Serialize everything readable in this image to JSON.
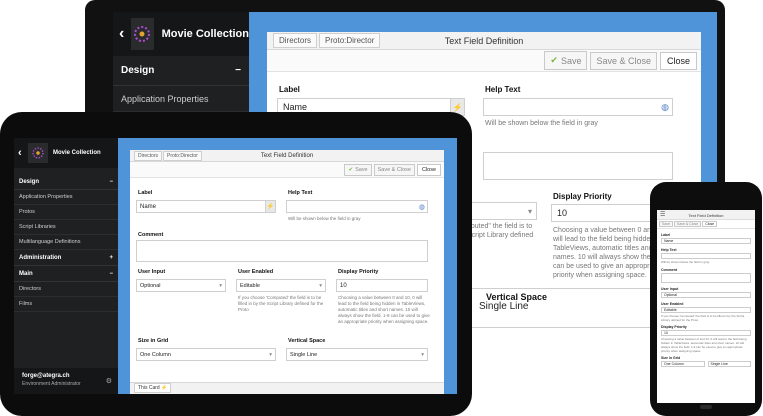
{
  "app": {
    "title": "Movie Collection",
    "sidebar": {
      "sections": [
        {
          "label": "Design",
          "toggle": "−",
          "items": [
            "Application Properties",
            "Protos",
            "Script Libraries",
            "Multilanguage Definitions"
          ]
        },
        {
          "label": "Administration",
          "toggle": "+",
          "items": []
        },
        {
          "label": "Main",
          "toggle": "−",
          "items": [
            "Directors",
            "Films"
          ]
        }
      ],
      "user_email": "forge@ategra.ch",
      "user_role": "Environment Administrator"
    }
  },
  "panel": {
    "breadcrumbs": [
      "Directors",
      "Proto:Director"
    ],
    "title": "Text Field Definition",
    "toolbar": {
      "save": "Save",
      "save_close": "Save & Close",
      "close": "Close"
    },
    "footer_tab": "This Card"
  },
  "form": {
    "label": {
      "label": "Label",
      "value": "Name"
    },
    "help_text": {
      "label": "Help Text",
      "value": "",
      "hint": "Will be shown below the field in gray"
    },
    "comment": {
      "label": "Comment",
      "value": ""
    },
    "user_input": {
      "label": "User Input",
      "value": "Optional"
    },
    "user_enabled": {
      "label": "User Enabled",
      "value": "Editable",
      "hint": "If you choose 'Computed' the field is to be filled in by the Script Library defined for the Proto"
    },
    "display_priority": {
      "label": "Display Priority",
      "value": "10",
      "hint": "Choosing a value between 0 and 10, 0 will lead to the field being hidden in TableViews, automatic titles and short names. 10 will always show the field. 1-9 can be used to give an appropriate priority when assigning space."
    },
    "size_in_grid": {
      "label": "Size in Grid",
      "value": "One Column"
    },
    "vertical_space": {
      "label": "Vertical Space",
      "value": "Single Line"
    }
  },
  "back_fragments": {
    "computed_fragment": "nputed\" the field is to",
    "script_fragment": "Script Library defined",
    "priority_hint_lines": [
      "Choosing a value between 0 and",
      "will lead to the field being hidden",
      "TableViews, automatic titles and s",
      "names. 10 will always show the fie",
      "can be used to give an appropria",
      "priority when assigning space."
    ]
  },
  "colors": {
    "accent": "#4f93d8",
    "sidebar": "#1f2022",
    "device": "#0c0c0c"
  }
}
